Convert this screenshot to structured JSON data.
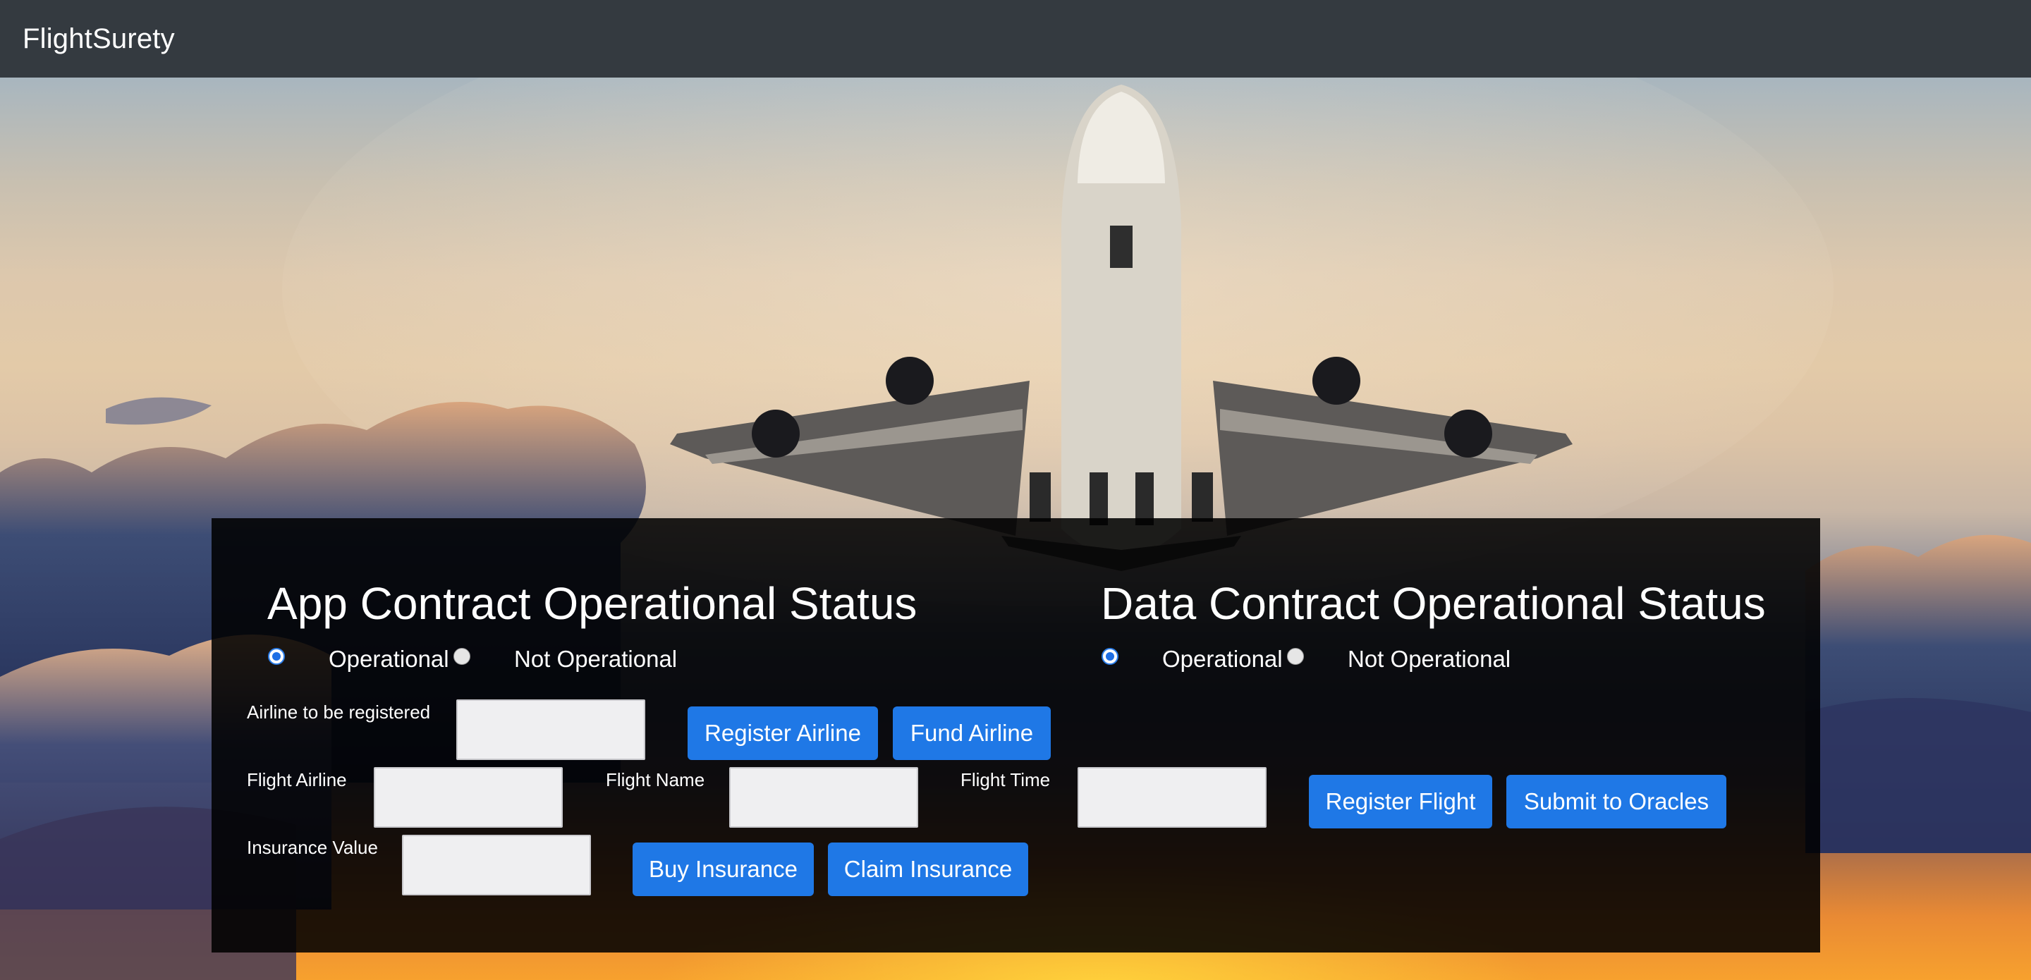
{
  "navbar": {
    "brand": "FlightSurety"
  },
  "app_contract": {
    "title": "App Contract Operational Status",
    "options": [
      {
        "label": "Operational",
        "selected": true
      },
      {
        "label": "Not Operational",
        "selected": false
      }
    ]
  },
  "data_contract": {
    "title": "Data Contract Operational Status",
    "options": [
      {
        "label": "Operational",
        "selected": true
      },
      {
        "label": "Not Operational",
        "selected": false
      }
    ]
  },
  "airline_form": {
    "label": "Airline to be registered",
    "value": "",
    "register_button": "Register Airline",
    "fund_button": "Fund Airline"
  },
  "flight_form": {
    "airline_label": "Flight Airline",
    "airline_value": "",
    "name_label": "Flight Name",
    "name_value": "",
    "time_label": "Flight Time",
    "time_value": "",
    "register_button": "Register Flight",
    "oracles_button": "Submit to Oracles"
  },
  "insurance_form": {
    "label": "Insurance Value",
    "value": "",
    "buy_button": "Buy Insurance",
    "claim_button": "Claim Insurance"
  },
  "colors": {
    "navbar_bg": "#343a40",
    "button_bg": "#1f78e6",
    "panel_bg": "rgba(0,0,0,0.87)"
  }
}
